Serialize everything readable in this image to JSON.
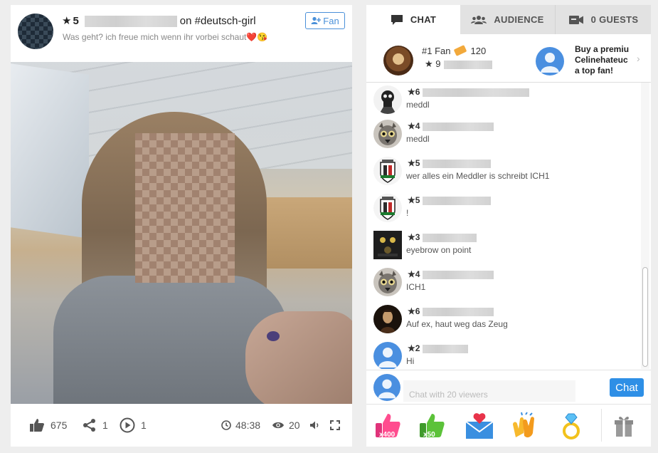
{
  "broadcaster": {
    "level": "5",
    "tag_text": "on #deutsch-girl",
    "subtitle": "Was geht? ich freue mich wenn ihr vorbei schaut",
    "subtitle_emoji": "❤️😘",
    "fan_button": "Fan"
  },
  "video_bar": {
    "likes": "675",
    "shares": "1",
    "replays": "1",
    "duration": "48:38",
    "viewers": "20"
  },
  "tabs": {
    "chat": "CHAT",
    "audience": "AUDIENCE",
    "guests": "0 GUESTS"
  },
  "top_fan": {
    "rank_label": "#1 Fan",
    "points": "120",
    "level": "9"
  },
  "premium_prompt": {
    "line1": "Buy a premiu",
    "line2": "Celinehateuc",
    "line3": "a top fan!"
  },
  "messages": [
    {
      "level": "6",
      "text": "meddl",
      "avatar": "skull-bw"
    },
    {
      "level": "4",
      "text": "meddl",
      "avatar": "lemur"
    },
    {
      "level": "5",
      "text": "wer alles ein Meddler is schreibt ICH1",
      "avatar": "coat-of-arms"
    },
    {
      "level": "5",
      "text": "!",
      "avatar": "coat-of-arms"
    },
    {
      "level": "3",
      "text": "eyebrow on point",
      "avatar": "dark-figures"
    },
    {
      "level": "4",
      "text": "ICH1",
      "avatar": "lemur"
    },
    {
      "level": "6",
      "text": "Auf ex, haut weg das Zeug",
      "avatar": "portrait-dark"
    },
    {
      "level": "2",
      "text": "Hi",
      "avatar": "default-user"
    }
  ],
  "chat_input": {
    "placeholder": "Chat with 20 viewers",
    "send_label": "Chat"
  },
  "gifts": [
    {
      "name": "like-gift",
      "label": "x400"
    },
    {
      "name": "like-gift-green",
      "label": "x50"
    },
    {
      "name": "love-letter-gift",
      "label": ""
    },
    {
      "name": "clapping-hands-gift",
      "label": ""
    },
    {
      "name": "diamond-ring-gift",
      "label": ""
    }
  ],
  "colors": {
    "accent_blue": "#2e8fe6",
    "avatar_blue": "#4a8fe0"
  }
}
